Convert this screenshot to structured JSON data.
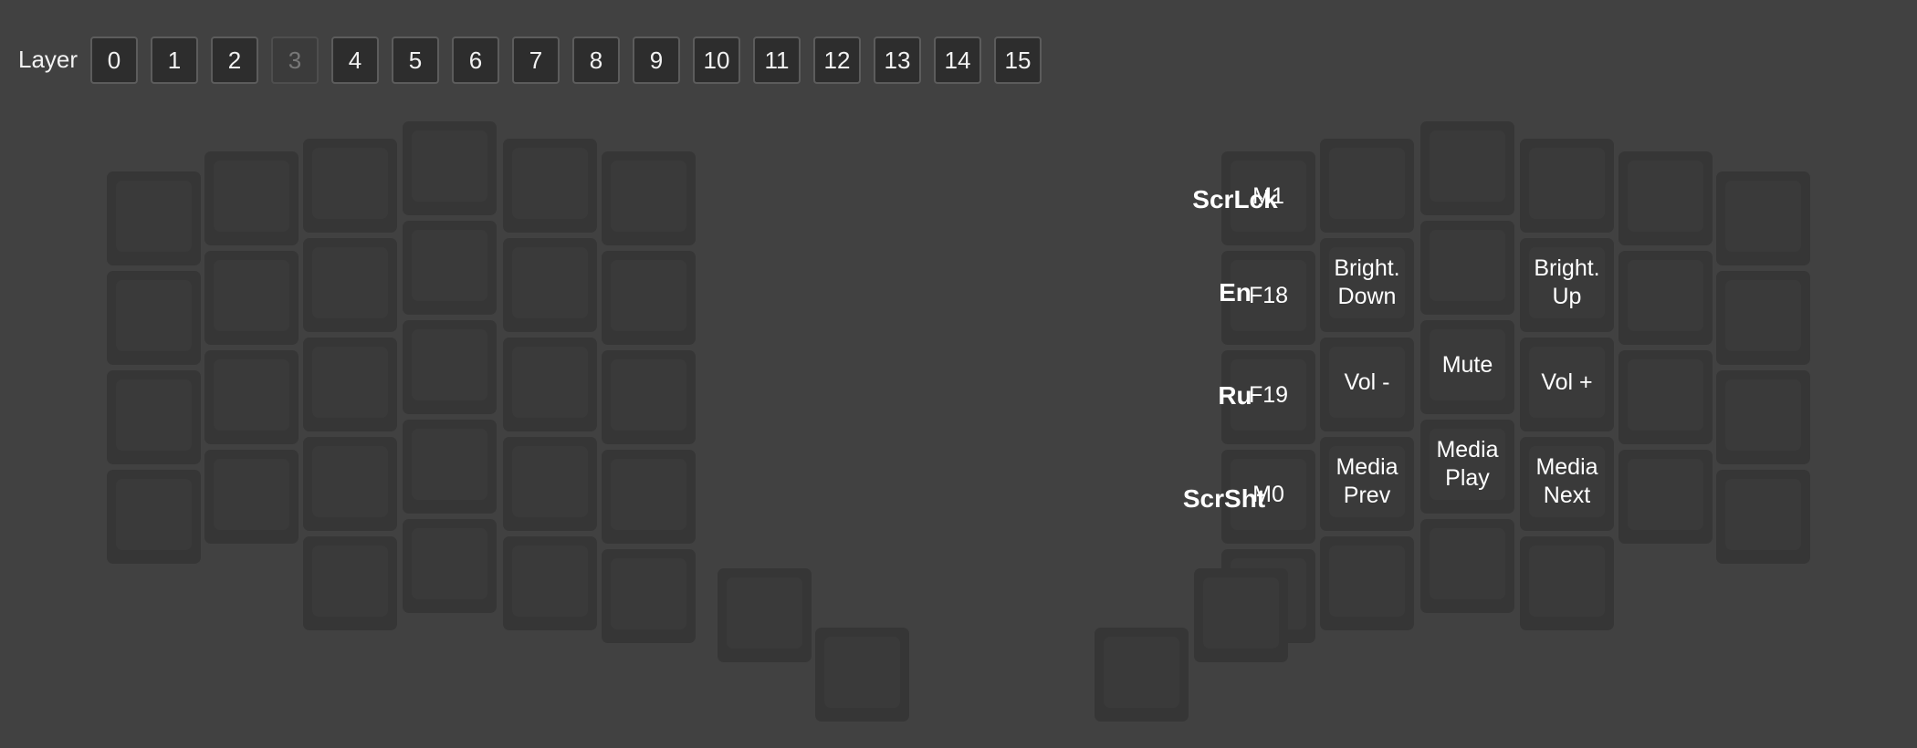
{
  "layer_bar": {
    "label": "Layer",
    "active_layer": "3",
    "layers": [
      "0",
      "1",
      "2",
      "3",
      "4",
      "5",
      "6",
      "7",
      "8",
      "9",
      "10",
      "11",
      "12",
      "13",
      "14",
      "15"
    ]
  },
  "row_labels": [
    "ScrLck",
    "En",
    "Ru",
    "ScrSht"
  ],
  "keys": {
    "r0c0": "M1",
    "r1c0": "F18",
    "r1c1": "Bright.\nDown",
    "r1c3": "Bright.\nUp",
    "r2c0": "F19",
    "r2c1": "Vol -",
    "r2c2": "Mute",
    "r2c3": "Vol +",
    "r3c0": "M0",
    "r3c1": "Media\nPrev",
    "r3c2": "Media\nPlay",
    "r3c3": "Media\nNext"
  },
  "colors": {
    "background": "#414141",
    "key_base": "#363636",
    "key_cap": "#3a3a3a",
    "text": "#ffffff"
  }
}
